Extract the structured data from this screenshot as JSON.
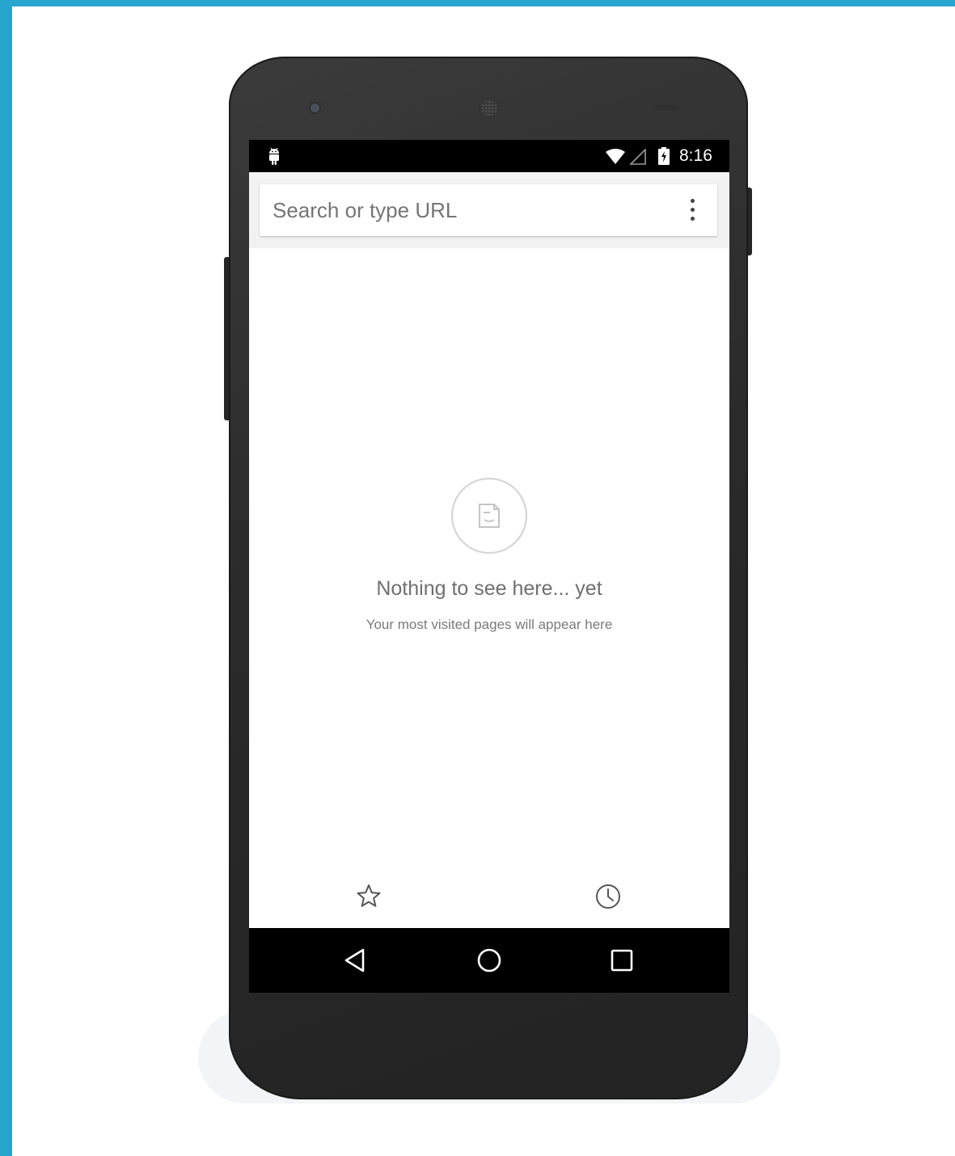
{
  "status_bar": {
    "time": "8:16",
    "icons": [
      "android-notification-icon",
      "wifi-icon",
      "cellular-signal-icon",
      "battery-charging-icon"
    ]
  },
  "toolbar": {
    "search_placeholder": "Search or type URL",
    "menu_icon": "overflow-menu-icon"
  },
  "empty_state": {
    "icon": "page-icon",
    "title": "Nothing to see here... yet",
    "subtitle": "Your most visited pages will appear here"
  },
  "bottom_bar": {
    "left_icon": "bookmarks-star-icon",
    "right_icon": "history-clock-icon"
  },
  "nav_bar": {
    "icons": [
      "back-icon",
      "home-icon",
      "recents-icon"
    ]
  },
  "colors": {
    "frame_accent": "#26a5cf",
    "phone_body": "#2a2a2a",
    "toolbar_bg": "#f2f2f2"
  }
}
